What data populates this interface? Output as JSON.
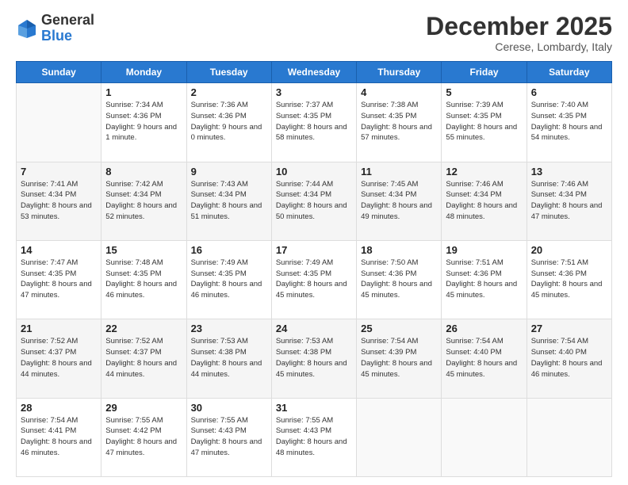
{
  "logo": {
    "general": "General",
    "blue": "Blue"
  },
  "header": {
    "month": "December 2025",
    "location": "Cerese, Lombardy, Italy"
  },
  "weekdays": [
    "Sunday",
    "Monday",
    "Tuesday",
    "Wednesday",
    "Thursday",
    "Friday",
    "Saturday"
  ],
  "weeks": [
    [
      {
        "day": "",
        "sunrise": "",
        "sunset": "",
        "daylight": ""
      },
      {
        "day": "1",
        "sunrise": "Sunrise: 7:34 AM",
        "sunset": "Sunset: 4:36 PM",
        "daylight": "Daylight: 9 hours and 1 minute."
      },
      {
        "day": "2",
        "sunrise": "Sunrise: 7:36 AM",
        "sunset": "Sunset: 4:36 PM",
        "daylight": "Daylight: 9 hours and 0 minutes."
      },
      {
        "day": "3",
        "sunrise": "Sunrise: 7:37 AM",
        "sunset": "Sunset: 4:35 PM",
        "daylight": "Daylight: 8 hours and 58 minutes."
      },
      {
        "day": "4",
        "sunrise": "Sunrise: 7:38 AM",
        "sunset": "Sunset: 4:35 PM",
        "daylight": "Daylight: 8 hours and 57 minutes."
      },
      {
        "day": "5",
        "sunrise": "Sunrise: 7:39 AM",
        "sunset": "Sunset: 4:35 PM",
        "daylight": "Daylight: 8 hours and 55 minutes."
      },
      {
        "day": "6",
        "sunrise": "Sunrise: 7:40 AM",
        "sunset": "Sunset: 4:35 PM",
        "daylight": "Daylight: 8 hours and 54 minutes."
      }
    ],
    [
      {
        "day": "7",
        "sunrise": "Sunrise: 7:41 AM",
        "sunset": "Sunset: 4:34 PM",
        "daylight": "Daylight: 8 hours and 53 minutes."
      },
      {
        "day": "8",
        "sunrise": "Sunrise: 7:42 AM",
        "sunset": "Sunset: 4:34 PM",
        "daylight": "Daylight: 8 hours and 52 minutes."
      },
      {
        "day": "9",
        "sunrise": "Sunrise: 7:43 AM",
        "sunset": "Sunset: 4:34 PM",
        "daylight": "Daylight: 8 hours and 51 minutes."
      },
      {
        "day": "10",
        "sunrise": "Sunrise: 7:44 AM",
        "sunset": "Sunset: 4:34 PM",
        "daylight": "Daylight: 8 hours and 50 minutes."
      },
      {
        "day": "11",
        "sunrise": "Sunrise: 7:45 AM",
        "sunset": "Sunset: 4:34 PM",
        "daylight": "Daylight: 8 hours and 49 minutes."
      },
      {
        "day": "12",
        "sunrise": "Sunrise: 7:46 AM",
        "sunset": "Sunset: 4:34 PM",
        "daylight": "Daylight: 8 hours and 48 minutes."
      },
      {
        "day": "13",
        "sunrise": "Sunrise: 7:46 AM",
        "sunset": "Sunset: 4:34 PM",
        "daylight": "Daylight: 8 hours and 47 minutes."
      }
    ],
    [
      {
        "day": "14",
        "sunrise": "Sunrise: 7:47 AM",
        "sunset": "Sunset: 4:35 PM",
        "daylight": "Daylight: 8 hours and 47 minutes."
      },
      {
        "day": "15",
        "sunrise": "Sunrise: 7:48 AM",
        "sunset": "Sunset: 4:35 PM",
        "daylight": "Daylight: 8 hours and 46 minutes."
      },
      {
        "day": "16",
        "sunrise": "Sunrise: 7:49 AM",
        "sunset": "Sunset: 4:35 PM",
        "daylight": "Daylight: 8 hours and 46 minutes."
      },
      {
        "day": "17",
        "sunrise": "Sunrise: 7:49 AM",
        "sunset": "Sunset: 4:35 PM",
        "daylight": "Daylight: 8 hours and 45 minutes."
      },
      {
        "day": "18",
        "sunrise": "Sunrise: 7:50 AM",
        "sunset": "Sunset: 4:36 PM",
        "daylight": "Daylight: 8 hours and 45 minutes."
      },
      {
        "day": "19",
        "sunrise": "Sunrise: 7:51 AM",
        "sunset": "Sunset: 4:36 PM",
        "daylight": "Daylight: 8 hours and 45 minutes."
      },
      {
        "day": "20",
        "sunrise": "Sunrise: 7:51 AM",
        "sunset": "Sunset: 4:36 PM",
        "daylight": "Daylight: 8 hours and 45 minutes."
      }
    ],
    [
      {
        "day": "21",
        "sunrise": "Sunrise: 7:52 AM",
        "sunset": "Sunset: 4:37 PM",
        "daylight": "Daylight: 8 hours and 44 minutes."
      },
      {
        "day": "22",
        "sunrise": "Sunrise: 7:52 AM",
        "sunset": "Sunset: 4:37 PM",
        "daylight": "Daylight: 8 hours and 44 minutes."
      },
      {
        "day": "23",
        "sunrise": "Sunrise: 7:53 AM",
        "sunset": "Sunset: 4:38 PM",
        "daylight": "Daylight: 8 hours and 44 minutes."
      },
      {
        "day": "24",
        "sunrise": "Sunrise: 7:53 AM",
        "sunset": "Sunset: 4:38 PM",
        "daylight": "Daylight: 8 hours and 45 minutes."
      },
      {
        "day": "25",
        "sunrise": "Sunrise: 7:54 AM",
        "sunset": "Sunset: 4:39 PM",
        "daylight": "Daylight: 8 hours and 45 minutes."
      },
      {
        "day": "26",
        "sunrise": "Sunrise: 7:54 AM",
        "sunset": "Sunset: 4:40 PM",
        "daylight": "Daylight: 8 hours and 45 minutes."
      },
      {
        "day": "27",
        "sunrise": "Sunrise: 7:54 AM",
        "sunset": "Sunset: 4:40 PM",
        "daylight": "Daylight: 8 hours and 46 minutes."
      }
    ],
    [
      {
        "day": "28",
        "sunrise": "Sunrise: 7:54 AM",
        "sunset": "Sunset: 4:41 PM",
        "daylight": "Daylight: 8 hours and 46 minutes."
      },
      {
        "day": "29",
        "sunrise": "Sunrise: 7:55 AM",
        "sunset": "Sunset: 4:42 PM",
        "daylight": "Daylight: 8 hours and 47 minutes."
      },
      {
        "day": "30",
        "sunrise": "Sunrise: 7:55 AM",
        "sunset": "Sunset: 4:43 PM",
        "daylight": "Daylight: 8 hours and 47 minutes."
      },
      {
        "day": "31",
        "sunrise": "Sunrise: 7:55 AM",
        "sunset": "Sunset: 4:43 PM",
        "daylight": "Daylight: 8 hours and 48 minutes."
      },
      {
        "day": "",
        "sunrise": "",
        "sunset": "",
        "daylight": ""
      },
      {
        "day": "",
        "sunrise": "",
        "sunset": "",
        "daylight": ""
      },
      {
        "day": "",
        "sunrise": "",
        "sunset": "",
        "daylight": ""
      }
    ]
  ]
}
